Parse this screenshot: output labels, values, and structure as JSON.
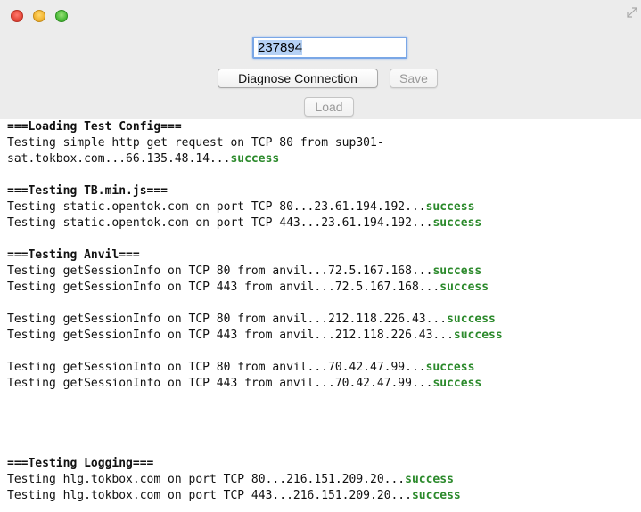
{
  "window": {
    "controls": [
      "close",
      "minimize",
      "zoom"
    ]
  },
  "input": {
    "value": "237894"
  },
  "buttons": {
    "diagnose": "Diagnose Connection",
    "save": "Save",
    "load": "Load"
  },
  "log": {
    "loading_header": "===Loading Test Config===",
    "loading_line1": "Testing simple http get request on TCP 80 from sup301-",
    "loading_line2_prefix": "sat.tokbox.com...66.135.48.14...",
    "tb_header": "===Testing TB.min.js===",
    "tb_line1_prefix": "Testing static.opentok.com on port TCP 80...23.61.194.192...",
    "tb_line2_prefix": "Testing static.opentok.com on port TCP 443...23.61.194.192...",
    "anvil_header": "===Testing Anvil===",
    "anvil_line1_prefix": "Testing getSessionInfo on TCP 80 from anvil...72.5.167.168...",
    "anvil_line2_prefix": "Testing getSessionInfo on TCP 443 from anvil...72.5.167.168...",
    "anvil_line3_prefix": "Testing getSessionInfo on TCP 80 from anvil...212.118.226.43...",
    "anvil_line4_prefix": "Testing getSessionInfo on TCP 443 from anvil...212.118.226.43...",
    "anvil_line5_prefix": "Testing getSessionInfo on TCP 80 from anvil...70.42.47.99...",
    "anvil_line6_prefix": "Testing getSessionInfo on TCP 443 from anvil...70.42.47.99...",
    "logging_header": "===Testing Logging===",
    "logging_line1_prefix": "Testing hlg.tokbox.com on port TCP 80...216.151.209.20...",
    "logging_line2_prefix": "Testing hlg.tokbox.com on port TCP 443...216.151.209.20...",
    "status_success": "success",
    "success_color": "#2c8a2c"
  }
}
